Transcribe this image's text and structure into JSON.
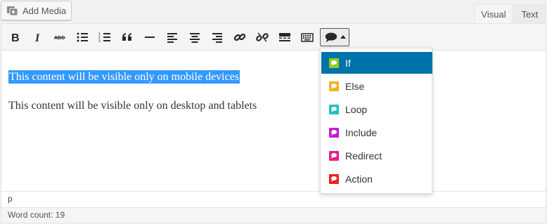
{
  "toolbar": {
    "add_media_label": "Add Media",
    "tabs": {
      "visual": "Visual",
      "text": "Text"
    },
    "buttons": [
      "bold",
      "italic",
      "strikethrough",
      "bulleted-list",
      "numbered-list",
      "blockquote",
      "horizontal-line",
      "align-left",
      "align-center",
      "align-right",
      "insert-link",
      "remove-link",
      "read-more",
      "toolbar-toggle",
      "shortcode-dropdown"
    ]
  },
  "content": {
    "line1": "This content will be visible only on mobile devices",
    "line2": "This content will be visible only on desktop and tablets"
  },
  "status": {
    "path": "p",
    "word_count": "Word count: 19"
  },
  "menu": {
    "items": [
      {
        "label": "If",
        "color": "#8fcc1f",
        "icon": "speech-bubble-icon"
      },
      {
        "label": "Else",
        "color": "#f0b322",
        "icon": "speech-bubble-icon"
      },
      {
        "label": "Loop",
        "color": "#20c2c2",
        "icon": "speech-bubble-icon"
      },
      {
        "label": "Include",
        "color": "#c21fd1",
        "icon": "speech-bubble-icon"
      },
      {
        "label": "Redirect",
        "color": "#e8208a",
        "icon": "speech-bubble-icon"
      },
      {
        "label": "Action",
        "color": "#e8261c",
        "icon": "speech-bubble-icon"
      }
    ],
    "highlight_color": "#0073aa"
  }
}
